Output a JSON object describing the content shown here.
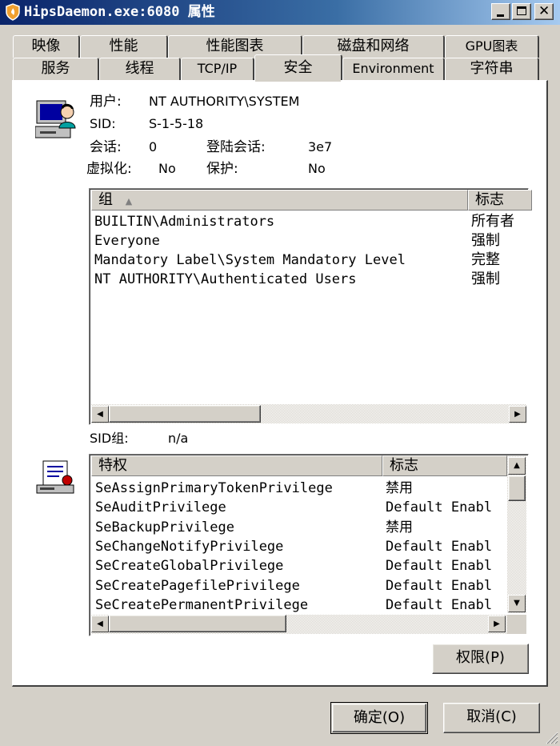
{
  "window": {
    "title": "HipsDaemon.exe:6080 属性"
  },
  "tabs_row1": [
    "映像",
    "性能",
    "性能图表",
    "磁盘和网络",
    "GPU图表"
  ],
  "tabs_row2": [
    "服务",
    "线程",
    "TCP/IP",
    "安全",
    "Environment",
    "字符串"
  ],
  "active_tab": "安全",
  "info": {
    "user_label": "用户:",
    "user_value": "NT AUTHORITY\\SYSTEM",
    "sid_label": "SID:",
    "sid_value": "S-1-5-18",
    "session_label": "会话:",
    "session_value": "0",
    "logon_session_label": "登陆会话:",
    "logon_session_value": "3e7",
    "virtualization_label": "虚拟化:",
    "virtualization_value": "No",
    "protection_label": "保护:",
    "protection_value": "No"
  },
  "groups_table": {
    "col_group": "组",
    "col_flags": "标志",
    "rows": [
      {
        "group": "BUILTIN\\Administrators",
        "flags": "所有者"
      },
      {
        "group": "Everyone",
        "flags": "强制"
      },
      {
        "group": "Mandatory Label\\System Mandatory Level",
        "flags": "完整"
      },
      {
        "group": "NT AUTHORITY\\Authenticated Users",
        "flags": "强制"
      }
    ]
  },
  "sid_group": {
    "label": "SID组:",
    "value": "n/a"
  },
  "privileges_table": {
    "col_privilege": "特权",
    "col_flags": "标志",
    "rows": [
      {
        "privilege": "SeAssignPrimaryTokenPrivilege",
        "flags": "禁用"
      },
      {
        "privilege": "SeAuditPrivilege",
        "flags": "Default Enabl"
      },
      {
        "privilege": "SeBackupPrivilege",
        "flags": "禁用"
      },
      {
        "privilege": "SeChangeNotifyPrivilege",
        "flags": "Default Enabl"
      },
      {
        "privilege": "SeCreateGlobalPrivilege",
        "flags": "Default Enabl"
      },
      {
        "privilege": "SeCreatePagefilePrivilege",
        "flags": "Default Enabl"
      },
      {
        "privilege": "SeCreatePermanentPrivilege",
        "flags": "Default Enabl"
      }
    ]
  },
  "buttons": {
    "permissions": "权限(P)",
    "ok": "确定(O)",
    "cancel": "取消(C)"
  },
  "colors": {
    "title_start": "#0a246a",
    "title_end": "#a6caf0",
    "face": "#d4d0c8"
  }
}
